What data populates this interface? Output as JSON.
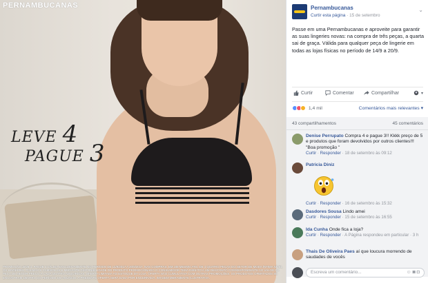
{
  "photo": {
    "brand": "PERNAMBUCANAS",
    "promo_leve": "LEVE",
    "promo_leve_num": "4",
    "promo_pague": "PAGUE",
    "promo_pague_num": "3",
    "fine_print": "PROMOÇÃO LEVE 4, PAGUE 3 VÁLIDA EXCLUSIVAMENTE NO PERÍODO DE 14/9/2017 A 20/9/2017, NAS COMPRAS, EM UM MESMO ATO, DE 4 QUATRO PEÇAS DO SETOR DE MODA ÍNTIMA NÍVEL OS LINGERIES, PIJAMAS E CAMISOLAS E MEDIANTE DISPONIBILIDADE DO PRODUTO PROMOCIONADO O CONSUMIDOR TERÁ DIREITO A UM DESCONTO CORRESPONDENTE AO VALOR DA PEÇA DE MENOR PREÇO A CADA QUATRO ADQUIRIDAS. OFERTA LIMITADA AO ESTOQUE DA LOJA. OFERTA NÃO CUMULATIVA COM OUTRAS PROMOÇÕES. OS PRODUTOS OFERTADOS SE ENCONTRAM DENTRO DO PERÍODO DO ANÚNCIO. A PRESENTE OFERTA SERÁ DADA POR ENCERRADA. IMAGEM MERAMENTE ILUSTRATIVA."
  },
  "header": {
    "page_name": "Pernambucanas",
    "like_page": "Curtir esta página",
    "separator": " · ",
    "date": "15 de setembro",
    "menu": "⌄"
  },
  "post": {
    "text": "Passe em uma Pernambucanas e aproveite para garantir as suas lingeries novas: na compra de três peças, a quarta sai de graça. Válida para qualquer peça de lingerie em todas as lojas físicas no período de 14/9 a 20/9."
  },
  "actions": {
    "like": "Curtir",
    "comment": "Comentar",
    "share": "Compartilhar"
  },
  "reactions": {
    "count": "1,4 mil",
    "filter": "Comentários mais relevantes",
    "colors": {
      "like": "#5890ff",
      "love": "#f25268",
      "haha": "#f7b125"
    }
  },
  "counts": {
    "shares": "43 compartilhamentos",
    "comments": "45 comentários"
  },
  "comments": [
    {
      "author": "Denise Perrupato",
      "text": "Compra 4 e pague 3!! Kkkk preço de 5 e produtos que foram devolvidos por outros clientes!!! \"Boa promoção \"",
      "like": "Curtir",
      "reply": "Responder",
      "time": "18 de setembro às 09:12",
      "avatar_color": "#8b9b6b"
    },
    {
      "author": "Patricia Diniz",
      "text": "",
      "like": "Curtir",
      "reply": "Responder",
      "time": "16 de setembro às 15:32",
      "avatar_color": "#6a4a3a"
    },
    {
      "author": "Dasdores Sousa",
      "text": "Lindo amei",
      "like": "Curtir",
      "reply": "Responder",
      "time": "15 de setembro às 16:55",
      "avatar_color": "#5a6a7a"
    },
    {
      "author": "Ida Cunha",
      "text": "Onde fica a loja?",
      "like": "Curtir",
      "reply": "Responder",
      "time": "A Página respondeu em particular",
      "extra": "3 h",
      "avatar_color": "#4a7a5a"
    },
    {
      "author": "Thais De Oliveira Paes",
      "text": "aí que loucura morrendo de saudades de vocês",
      "like": "",
      "reply": "",
      "time": "",
      "avatar_color": "#c8a080"
    }
  ],
  "write": {
    "placeholder": "Escreva um comentário..."
  }
}
